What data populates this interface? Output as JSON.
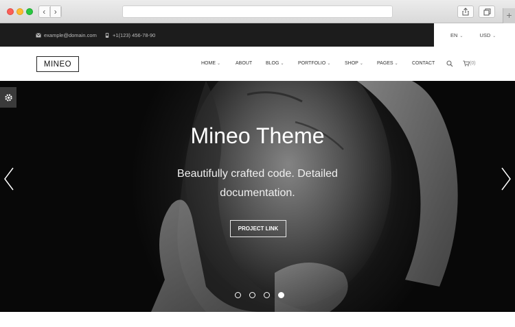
{
  "topbar": {
    "email": "example@domain.com",
    "phone": "+1(123) 456-78-90",
    "language": "EN",
    "currency": "USD"
  },
  "header": {
    "logo": "MINEO",
    "nav": [
      {
        "label": "HOME",
        "dropdown": true
      },
      {
        "label": "ABOUT",
        "dropdown": false
      },
      {
        "label": "BLOG",
        "dropdown": true
      },
      {
        "label": "PORTFOLIO",
        "dropdown": true
      },
      {
        "label": "SHOP",
        "dropdown": true
      },
      {
        "label": "PAGES",
        "dropdown": true
      },
      {
        "label": "CONTACT",
        "dropdown": false
      }
    ],
    "cart_count": "(0)"
  },
  "hero": {
    "title": "Mineo Theme",
    "subtitle": "Beautifully crafted code. Detailed documentation.",
    "button_label": "PROJECT LINK",
    "slides_total": 4,
    "active_slide": 4
  },
  "icons": {
    "back": "chevron-left-icon",
    "forward": "chevron-right-icon",
    "share": "share-icon",
    "tabs": "tabs-icon",
    "email": "envelope-icon",
    "phone": "phone-icon",
    "search": "search-icon",
    "cart": "cart-icon",
    "settings": "gear-icon"
  }
}
